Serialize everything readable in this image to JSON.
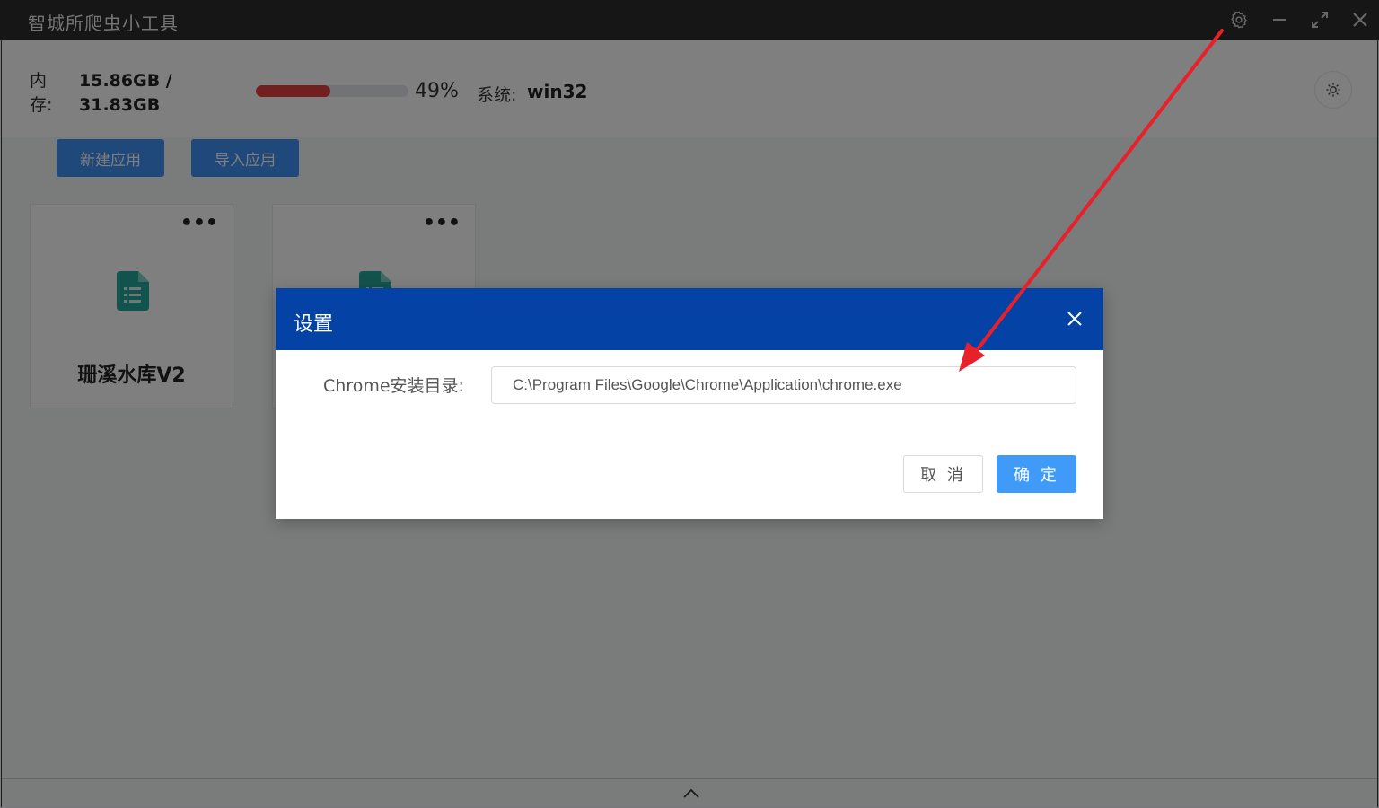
{
  "window": {
    "title": "智城所爬虫小工具"
  },
  "stats": {
    "memory_label": "内存:",
    "memory_value": "15.86GB / 31.83GB",
    "memory_fraction": 0.49,
    "memory_percent": "49%",
    "system_label": "系统:",
    "system_value": "win32"
  },
  "toolbar": {
    "new_app_label": "新建应用",
    "import_app_label": "导入应用"
  },
  "apps": [
    {
      "title": "珊溪水库V2",
      "menu": "•••"
    },
    {
      "title": "",
      "menu": "•••"
    }
  ],
  "dialog": {
    "title": "设置",
    "chrome_label": "Chrome安装目录:",
    "chrome_path": "C:\\Program Files\\Google\\Chrome\\Application\\chrome.exe",
    "cancel_label": "取 消",
    "ok_label": "确 定"
  },
  "colors": {
    "titlebar": "#2d2d2d",
    "dialog_header": "#0443a5",
    "primary": "#3f91f7",
    "progress_fill": "#e33f3f",
    "doc_icon": "#26a69a",
    "annotation_arrow": "#e8202a"
  },
  "icons": [
    "gear-icon",
    "minimize-icon",
    "maximize-icon",
    "close-icon",
    "sun-icon",
    "document-icon",
    "chevron-up-icon"
  ]
}
